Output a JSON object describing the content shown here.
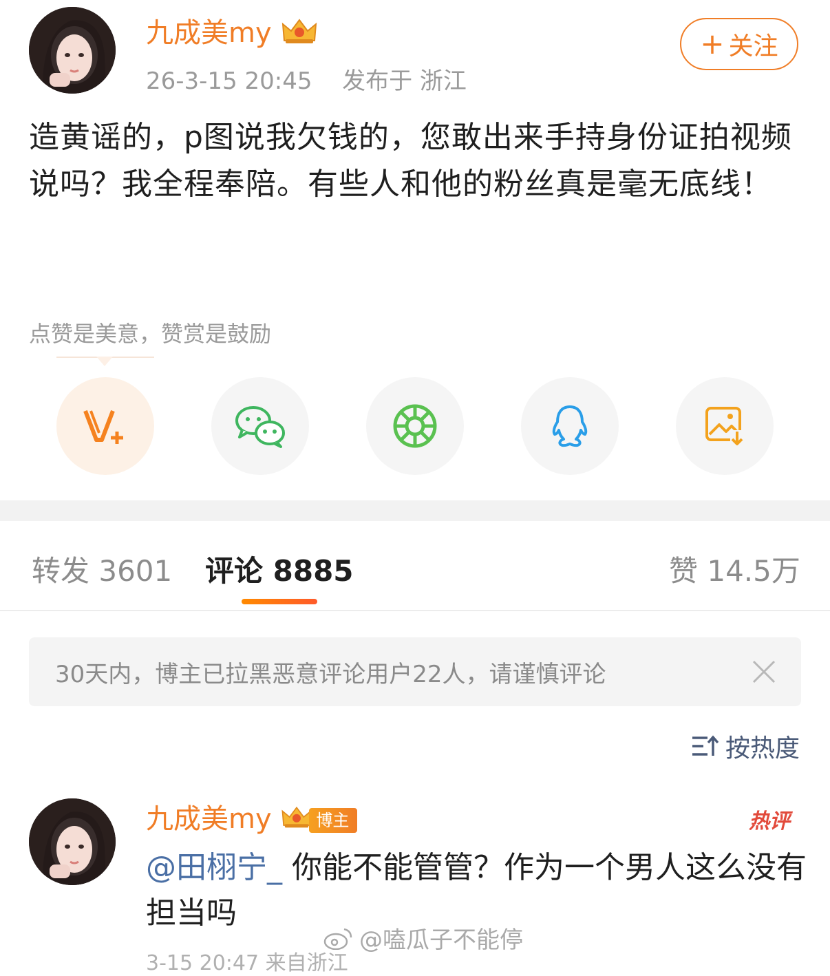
{
  "post": {
    "author": "九成美my",
    "timestamp": "26-3-15 20:45",
    "location": "发布于 浙江",
    "follow_label": "关注",
    "text": "造黄谣的，p图说我欠钱的，您敢出来手持身份证拍视频说吗？我全程奉陪。有些人和他的粉丝真是毫无底线！"
  },
  "reward_hint": "点赞是美意，赞赏是鼓励",
  "share": {
    "items": [
      {
        "icon": "reward-v-icon"
      },
      {
        "icon": "wechat-icon"
      },
      {
        "icon": "moments-icon"
      },
      {
        "icon": "qq-icon"
      },
      {
        "icon": "save-image-icon"
      }
    ]
  },
  "tabs": {
    "repost": "转发 3601",
    "comments": "评论 8885",
    "likes": "赞 14.5万"
  },
  "notice": "30天内，博主已拉黑恶意评论用户22人，请谨慎评论",
  "sort_label": "按热度",
  "comment": {
    "author": "九成美my",
    "badge": "博主",
    "hot_tag": "热评",
    "mention": "@田栩宁_",
    "text": " 你能不能管管？作为一个男人这么没有担当吗",
    "meta": "3-15 20:47  来自浙江"
  },
  "watermark": "@嗑瓜子不能停",
  "colors": {
    "accent": "#f07d26",
    "link": "#4a6fa5",
    "muted": "#9a9a9a"
  }
}
